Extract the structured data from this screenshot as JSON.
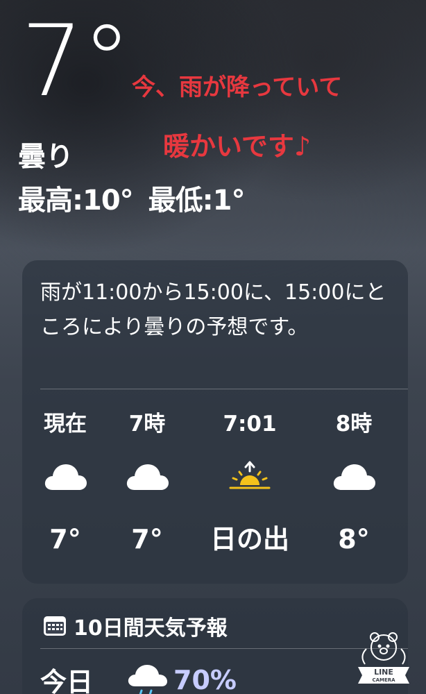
{
  "current": {
    "temperature": "7°",
    "condition": "曇り",
    "high": "最高:10°",
    "low": "最低:1°"
  },
  "annotations": {
    "line1": "今、雨が降っていて",
    "line2": "暖かいです♪",
    "color": "#e7383f"
  },
  "hourly_card": {
    "summary": "雨が11:00から15:00に、15:00にところにより曇りの予想です。",
    "hours": [
      {
        "label": "現在",
        "icon": "cloud-icon",
        "temp": "7°"
      },
      {
        "label": "7時",
        "icon": "cloud-icon",
        "temp": "7°"
      },
      {
        "label": "7:01",
        "icon": "sunrise-icon",
        "temp": "日の出"
      },
      {
        "label": "8時",
        "icon": "cloud-icon",
        "temp": "8°"
      }
    ]
  },
  "forecast_card": {
    "title": "10日間天気予報",
    "icon": "calendar-icon",
    "today_label": "今日",
    "today_icon": "cloud-rain-icon",
    "today_precip": "70%"
  },
  "watermark": {
    "line1": "LINE",
    "line2": "CAMERA",
    "icon": "bear-icon"
  },
  "colors": {
    "annotation": "#e7383f",
    "precip": "#c7ccff",
    "sunrise": "#f4c21b"
  }
}
